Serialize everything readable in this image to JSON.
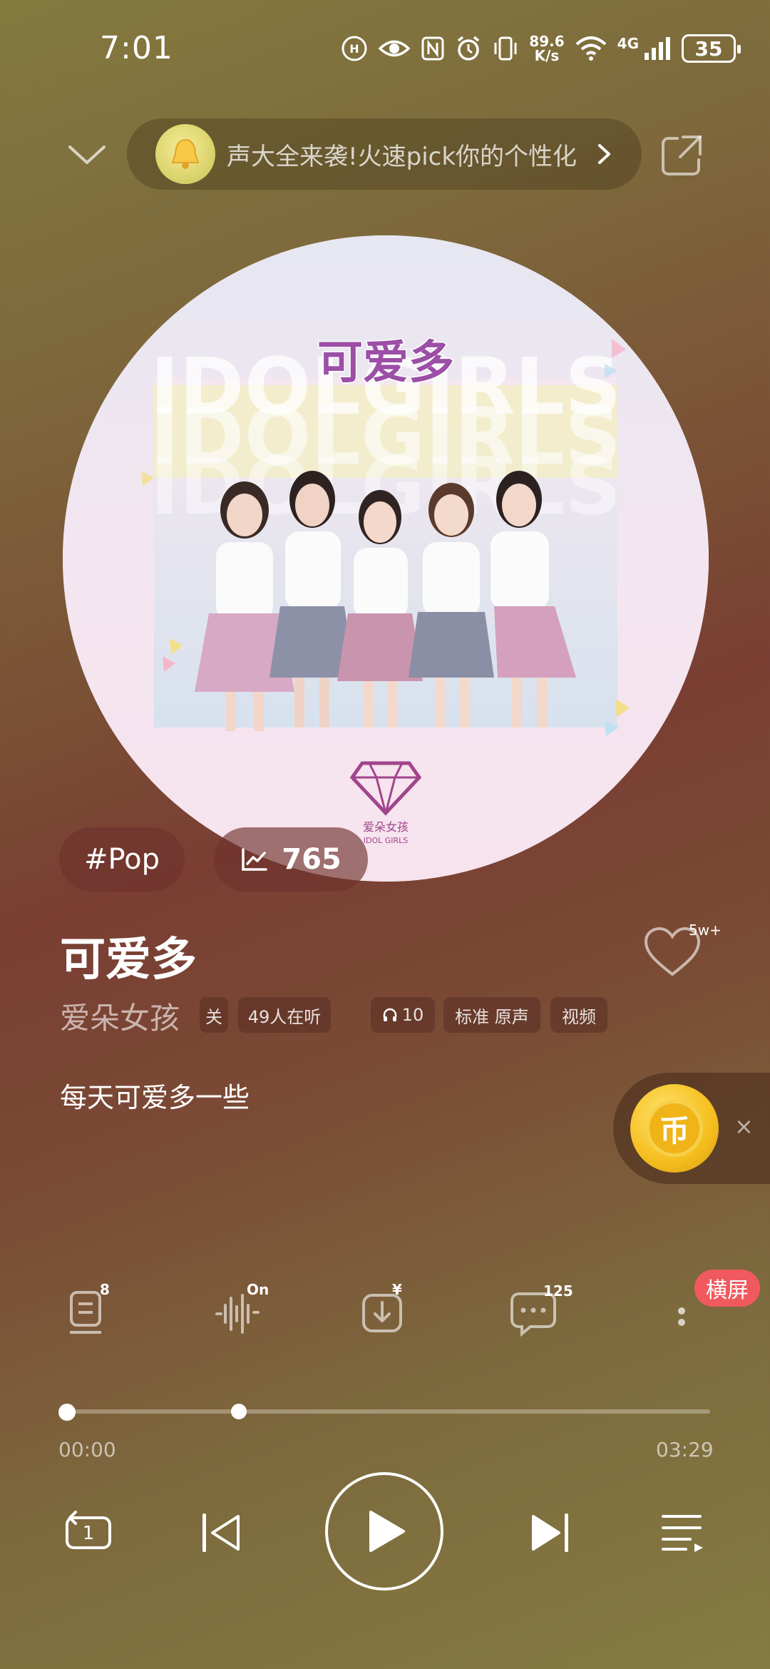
{
  "status_bar": {
    "time": "7:01",
    "net_speed_value": "89.6",
    "net_speed_unit": "K/s",
    "network_type": "4G",
    "battery": "35"
  },
  "top_bar": {
    "promo_text": "声大全来袭!火速pick你的个性化"
  },
  "tags": {
    "genre": "#Pop",
    "rank": "765"
  },
  "song": {
    "title": "可爱多",
    "artist": "爱朵女孩",
    "follow": "关",
    "listeners": "49人在听",
    "headphone_count": "10",
    "quality": "标准 原声",
    "video": "视频",
    "like_count": "5w+",
    "tagline": "每天可爱多一些"
  },
  "album_art": {
    "title_art": "可爱多",
    "watermark": "IDOLGIRLS",
    "logo_text": "爱朵女孩",
    "logo_subtext": "IDOL GIRLS"
  },
  "actions": {
    "lyrics_badge": "8",
    "sound_effect_badge": "On",
    "download_badge": "¥",
    "comments_badge": "125",
    "landscape_label": "横屏"
  },
  "coin_widget": {
    "coin_glyph": "币",
    "close": "×"
  },
  "player": {
    "current_time": "00:00",
    "total_time": "03:29",
    "repeat_count": "1",
    "progress": 0.0
  },
  "colors": {
    "landscape_badge": "#f0595e",
    "coin": "#f5be1e"
  }
}
